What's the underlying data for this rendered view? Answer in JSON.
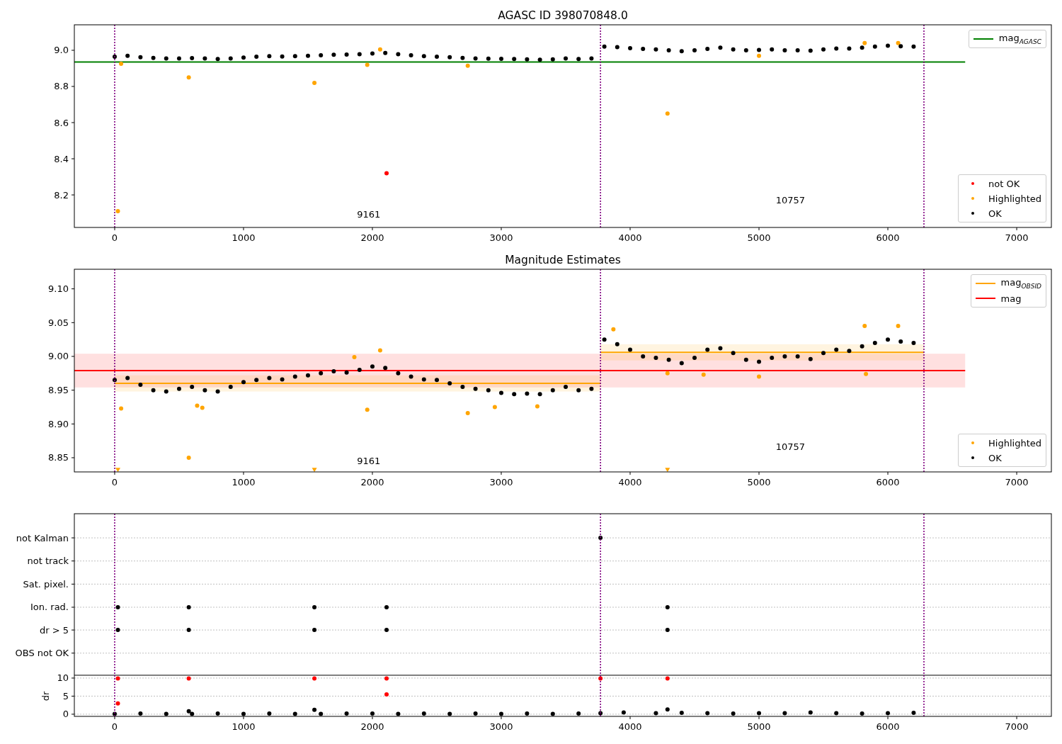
{
  "figure": {
    "panels": [
      {
        "chart_data": {
          "type": "scatter",
          "title": "AGASC ID 398070848.0",
          "xlim": [
            -313,
            7269
          ],
          "ylim": [
            8.02,
            9.141
          ],
          "xticks": [
            0,
            1000,
            2000,
            3000,
            4000,
            5000,
            6000,
            7000
          ],
          "yticks": [
            {
              "value": 8.2,
              "label": "8.2"
            },
            {
              "value": 8.4,
              "label": "8.4"
            },
            {
              "value": 8.6,
              "label": "8.6"
            },
            {
              "value": 8.8,
              "label": "8.8"
            },
            {
              "value": 9.0,
              "label": "9.0"
            }
          ],
          "series": [
            {
              "name": "mag$_{AGASC}$",
              "type": "line",
              "color": "#008000",
              "x": [
                -313,
                6600
              ],
              "values": [
                8.935,
                8.935
              ]
            },
            {
              "name": "not OK",
              "color": "#ff0000",
              "x": [
                2110
              ],
              "values": [
                8.32
              ]
            },
            {
              "name": "Highlighted",
              "color": "#ffa500",
              "x": [
                25,
                50,
                575,
                1550,
                1960,
                2060,
                2740,
                4290,
                5000,
                5820,
                6080
              ],
              "values": [
                8.11,
                8.925,
                8.85,
                8.82,
                8.92,
                9.005,
                8.915,
                8.65,
                8.97,
                9.04,
                9.04
              ]
            },
            {
              "name": "OK",
              "color": "#000000",
              "x": [
                0,
                100,
                200,
                300,
                400,
                500,
                600,
                700,
                800,
                900,
                1000,
                1100,
                1200,
                1300,
                1400,
                1500,
                1600,
                1700,
                1800,
                1900,
                2000,
                2100,
                2200,
                2300,
                2400,
                2500,
                2600,
                2700,
                2800,
                2900,
                3000,
                3100,
                3200,
                3300,
                3400,
                3500,
                3600,
                3700,
                3800,
                3900,
                4000,
                4100,
                4200,
                4300,
                4400,
                4500,
                4600,
                4700,
                4800,
                4900,
                5000,
                5100,
                5200,
                5300,
                5400,
                5500,
                5600,
                5700,
                5800,
                5900,
                6000,
                6100,
                6200
              ],
              "values": [
                8.965,
                8.97,
                8.962,
                8.958,
                8.955,
                8.955,
                8.957,
                8.955,
                8.952,
                8.955,
                8.96,
                8.965,
                8.968,
                8.966,
                8.968,
                8.97,
                8.972,
                8.975,
                8.976,
                8.978,
                8.982,
                8.985,
                8.978,
                8.972,
                8.968,
                8.965,
                8.962,
                8.958,
                8.955,
                8.954,
                8.953,
                8.952,
                8.95,
                8.948,
                8.95,
                8.955,
                8.952,
                8.955,
                9.02,
                9.018,
                9.012,
                9.008,
                9.005,
                9.0,
                8.995,
                9.0,
                9.008,
                9.015,
                9.005,
                9.0,
                9.002,
                9.005,
                9.0,
                9.0,
                8.998,
                9.005,
                9.01,
                9.01,
                9.015,
                9.02,
                9.025,
                9.022,
                9.02
              ]
            }
          ],
          "ref_lines": [
            {
              "axis": "x",
              "value": 0,
              "color": "#800080"
            },
            {
              "axis": "x",
              "value": 3770,
              "color": "#800080"
            },
            {
              "axis": "x",
              "value": 6280,
              "color": "#800080"
            }
          ],
          "annotations": [
            "9161",
            "10757"
          ]
        }
      },
      {
        "chart_data": {
          "type": "scatter",
          "title": "Magnitude Estimates",
          "xlim": [
            -313,
            7269
          ],
          "ylim": [
            8.829,
            9.129
          ],
          "xticks": [
            0,
            1000,
            2000,
            3000,
            4000,
            5000,
            6000,
            7000
          ],
          "yticks": [
            {
              "value": 8.85,
              "label": "8.85"
            },
            {
              "value": 8.9,
              "label": "8.90"
            },
            {
              "value": 8.95,
              "label": "8.95"
            },
            {
              "value": 9.0,
              "label": "9.00"
            },
            {
              "value": 9.05,
              "label": "9.05"
            },
            {
              "value": 9.1,
              "label": "9.10"
            }
          ],
          "series": [
            {
              "name": "mag$_{OBSID}$",
              "type": "line",
              "color": "#ffa500",
              "x": [
                0,
                3770
              ],
              "values": [
                8.96,
                8.96
              ]
            },
            {
              "type": "line",
              "color": "#ffa500",
              "x": [
                3770,
                6280
              ],
              "values": [
                9.006,
                9.006
              ]
            },
            {
              "name": "mag",
              "type": "line",
              "color": "#ff0000",
              "x": [
                -313,
                6600
              ],
              "values": [
                8.979,
                8.979
              ]
            },
            {
              "name": "Highlighted",
              "color": "#ffa500",
              "x": [
                50,
                575,
                640,
                680,
                1860,
                1960,
                2060,
                2740,
                2950,
                3280,
                3870,
                4290,
                4570,
                5000,
                5820,
                5830,
                6080
              ],
              "values": [
                8.923,
                8.85,
                8.927,
                8.924,
                8.999,
                8.921,
                9.009,
                8.916,
                8.925,
                8.926,
                9.04,
                8.975,
                8.973,
                8.97,
                9.045,
                8.974,
                9.045
              ]
            },
            {
              "name": "OK",
              "color": "#000000",
              "x": [
                0,
                100,
                200,
                300,
                400,
                500,
                600,
                700,
                800,
                900,
                1000,
                1100,
                1200,
                1300,
                1400,
                1500,
                1600,
                1700,
                1800,
                1900,
                2000,
                2100,
                2200,
                2300,
                2400,
                2500,
                2600,
                2700,
                2800,
                2900,
                3000,
                3100,
                3200,
                3300,
                3400,
                3500,
                3600,
                3700,
                3800,
                3900,
                4000,
                4100,
                4200,
                4300,
                4400,
                4500,
                4600,
                4700,
                4800,
                4900,
                5000,
                5100,
                5200,
                5300,
                5400,
                5500,
                5600,
                5700,
                5800,
                5900,
                6000,
                6100,
                6200
              ],
              "values": [
                8.965,
                8.968,
                8.958,
                8.95,
                8.948,
                8.952,
                8.955,
                8.95,
                8.948,
                8.955,
                8.962,
                8.965,
                8.968,
                8.966,
                8.97,
                8.972,
                8.975,
                8.978,
                8.976,
                8.98,
                8.985,
                8.983,
                8.975,
                8.97,
                8.966,
                8.965,
                8.96,
                8.955,
                8.952,
                8.95,
                8.946,
                8.944,
                8.945,
                8.944,
                8.95,
                8.955,
                8.95,
                8.952,
                9.025,
                9.018,
                9.01,
                9.0,
                8.998,
                8.995,
                8.99,
                8.998,
                9.01,
                9.012,
                9.005,
                8.995,
                8.992,
                8.998,
                9.0,
                9.0,
                8.996,
                9.005,
                9.01,
                9.008,
                9.015,
                9.02,
                9.025,
                9.022,
                9.02
              ]
            },
            {
              "marker": "v",
              "color": "#ffa500",
              "x": [
                25,
                1550,
                4290
              ],
              "values": [
                8.832,
                8.832,
                8.832
              ]
            }
          ],
          "bands": [
            {
              "axis": "y",
              "from": 8.954,
              "to": 9.004,
              "color": "#ff0000"
            },
            {
              "axis": "y",
              "from": 8.948,
              "to": 8.972,
              "color": "#ffa500"
            },
            {
              "axis": "y",
              "from": 8.994,
              "to": 9.018,
              "color": "#ffa500"
            }
          ],
          "ref_lines": [
            {
              "axis": "x",
              "value": 0,
              "color": "#800080"
            },
            {
              "axis": "x",
              "value": 3770,
              "color": "#800080"
            },
            {
              "axis": "x",
              "value": 6280,
              "color": "#800080"
            }
          ],
          "annotations": [
            "9161",
            "10757"
          ]
        }
      },
      {
        "chart_data": {
          "type": "scatter",
          "ylabel": "dr",
          "grid": true,
          "xlim": [
            -313,
            7269
          ],
          "ylim": [
            -0.6,
            55.48
          ],
          "xticks": [
            0,
            1000,
            2000,
            3000,
            4000,
            5000,
            6000,
            7000
          ],
          "yticks": [
            {
              "value": 0,
              "label": "0"
            },
            {
              "value": 5,
              "label": "5"
            },
            {
              "value": 10,
              "label": "10"
            },
            {
              "value": 16.9,
              "label": "OBS not OK"
            },
            {
              "value": 23.3,
              "label": "dr > 5"
            },
            {
              "value": 29.6,
              "label": "Ion. rad."
            },
            {
              "value": 36.0,
              "label": "Sat. pixel."
            },
            {
              "value": 42.4,
              "label": "not track"
            },
            {
              "value": 48.8,
              "label": "not Kalman"
            }
          ],
          "series": [
            {
              "color": "#000000",
              "x": [
                25,
                575,
                1550,
                2110,
                4290,
                25,
                575,
                1550,
                2110,
                4290,
                3770
              ],
              "values": [
                29.6,
                29.6,
                29.6,
                29.6,
                29.6,
                23.3,
                23.3,
                23.3,
                23.3,
                23.3,
                48.8
              ]
            },
            {
              "color": "#ff0000",
              "x": [
                25,
                575,
                1550,
                2110,
                3770,
                4290,
                25,
                2110
              ],
              "values": [
                9.9,
                9.9,
                9.9,
                9.9,
                9.9,
                9.9,
                3,
                5.5
              ]
            },
            {
              "color": "#000000",
              "x": [
                0,
                200,
                400,
                575,
                600,
                800,
                1000,
                1200,
                1400,
                1550,
                1600,
                1800,
                2000,
                2200,
                2400,
                2600,
                2800,
                3000,
                3200,
                3400,
                3600,
                3770,
                3950,
                4200,
                4290,
                4400,
                4600,
                4800,
                5000,
                5200,
                5400,
                5600,
                5800,
                6000,
                6200
              ],
              "values": [
                0.1,
                0.2,
                0.1,
                0.8,
                0.1,
                0.2,
                0.1,
                0.2,
                0.1,
                1.2,
                0.1,
                0.2,
                0.2,
                0.1,
                0.2,
                0.1,
                0.2,
                0.1,
                0.2,
                0.1,
                0.2,
                0.3,
                0.5,
                0.3,
                1.3,
                0.4,
                0.3,
                0.2,
                0.3,
                0.3,
                0.5,
                0.3,
                0.2,
                0.3,
                0.4
              ]
            }
          ],
          "ref_lines": [
            {
              "axis": "y",
              "value": 10.78,
              "color": "#000000"
            },
            {
              "axis": "x",
              "value": 0,
              "color": "#800080"
            },
            {
              "axis": "x",
              "value": 3770,
              "color": "#800080"
            },
            {
              "axis": "x",
              "value": 6280,
              "color": "#800080"
            }
          ]
        }
      }
    ]
  }
}
